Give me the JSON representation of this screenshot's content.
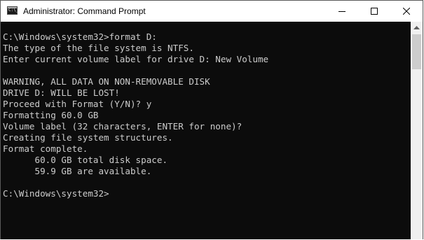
{
  "window": {
    "title": "Administrator: Command Prompt",
    "icon": "cmd-icon",
    "icon_glyph": "C:\\_"
  },
  "caption_buttons": {
    "minimize_icon": "minimize-icon",
    "maximize_icon": "maximize-icon",
    "close_icon": "close-icon"
  },
  "console": {
    "background_color": "#0c0c0c",
    "text_color": "#cccccc",
    "lines": [
      "C:\\Windows\\system32>format D:",
      "The type of the file system is NTFS.",
      "Enter current volume label for drive D: New Volume",
      "",
      "WARNING, ALL DATA ON NON-REMOVABLE DISK",
      "DRIVE D: WILL BE LOST!",
      "Proceed with Format (Y/N)? y",
      "Formatting 60.0 GB",
      "Volume label (32 characters, ENTER for none)?",
      "Creating file system structures.",
      "Format complete.",
      "      60.0 GB total disk space.",
      "      59.9 GB are available.",
      "",
      "C:\\Windows\\system32>"
    ]
  },
  "scrollbar": {
    "up_arrow_icon": "scroll-up-arrow-icon"
  }
}
